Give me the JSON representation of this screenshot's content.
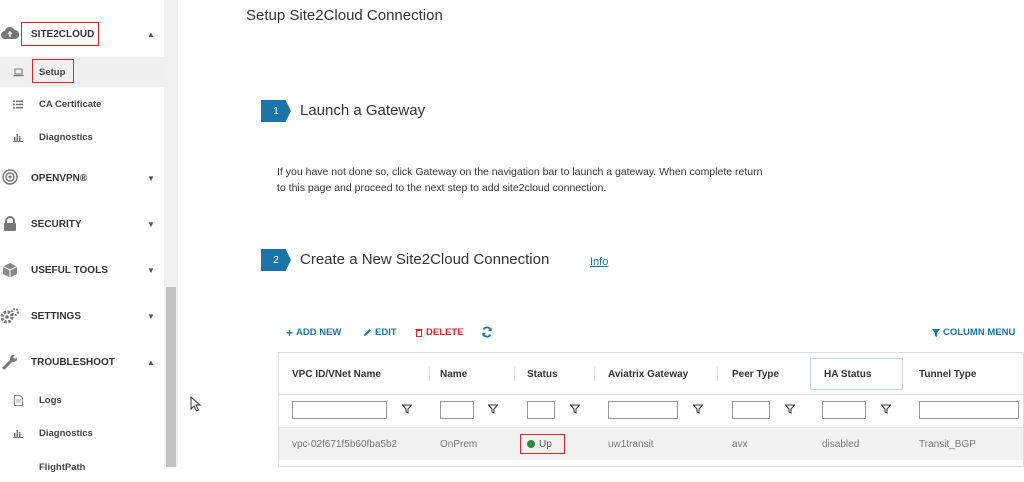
{
  "sidebar": {
    "site2cloud": {
      "label": "SITE2CLOUD"
    },
    "setup": {
      "label": "Setup"
    },
    "ca_certificate": {
      "label": "CA Certificate"
    },
    "diagnostics": {
      "label": "Diagnostics"
    },
    "openvpn": {
      "label": "OPENVPN®"
    },
    "security": {
      "label": "SECURITY"
    },
    "useful_tools": {
      "label": "USEFUL TOOLS"
    },
    "settings": {
      "label": "SETTINGS"
    },
    "troubleshoot": {
      "label": "TROUBLESHOOT"
    },
    "logs": {
      "label": "Logs"
    },
    "ts_diagnostics": {
      "label": "Diagnostics"
    },
    "flightpath": {
      "label": "FlightPath"
    }
  },
  "main": {
    "title": "Setup Site2Cloud Connection",
    "step1": {
      "number": "1",
      "title": "Launch a Gateway"
    },
    "description": "If you have not done so, click Gateway on the navigation bar to launch a gateway. When complete return to this page and proceed to the next step to add site2cloud connection.",
    "step2": {
      "number": "2",
      "title": "Create a New Site2Cloud Connection",
      "info": "Info"
    }
  },
  "toolbar": {
    "add_new": "ADD NEW",
    "edit": "EDIT",
    "delete": "DELETE",
    "column_menu": "COLUMN MENU"
  },
  "table": {
    "columns": [
      "VPC ID/VNet Name",
      "Name",
      "Status",
      "Aviatrix Gateway",
      "Peer Type",
      "HA Status",
      "Tunnel Type"
    ],
    "rows": [
      {
        "vpc": "vpc-02f671f5b60fba5b2",
        "name": "OnPrem",
        "status": "Up",
        "gateway": "uw1transit",
        "peer_type": "avx",
        "ha_status": "disabled",
        "tunnel_type": "Transit_BGP"
      }
    ]
  },
  "colors": {
    "accent": "#1c75a8",
    "danger": "#d9272e",
    "status_up": "#2e8b3d"
  }
}
